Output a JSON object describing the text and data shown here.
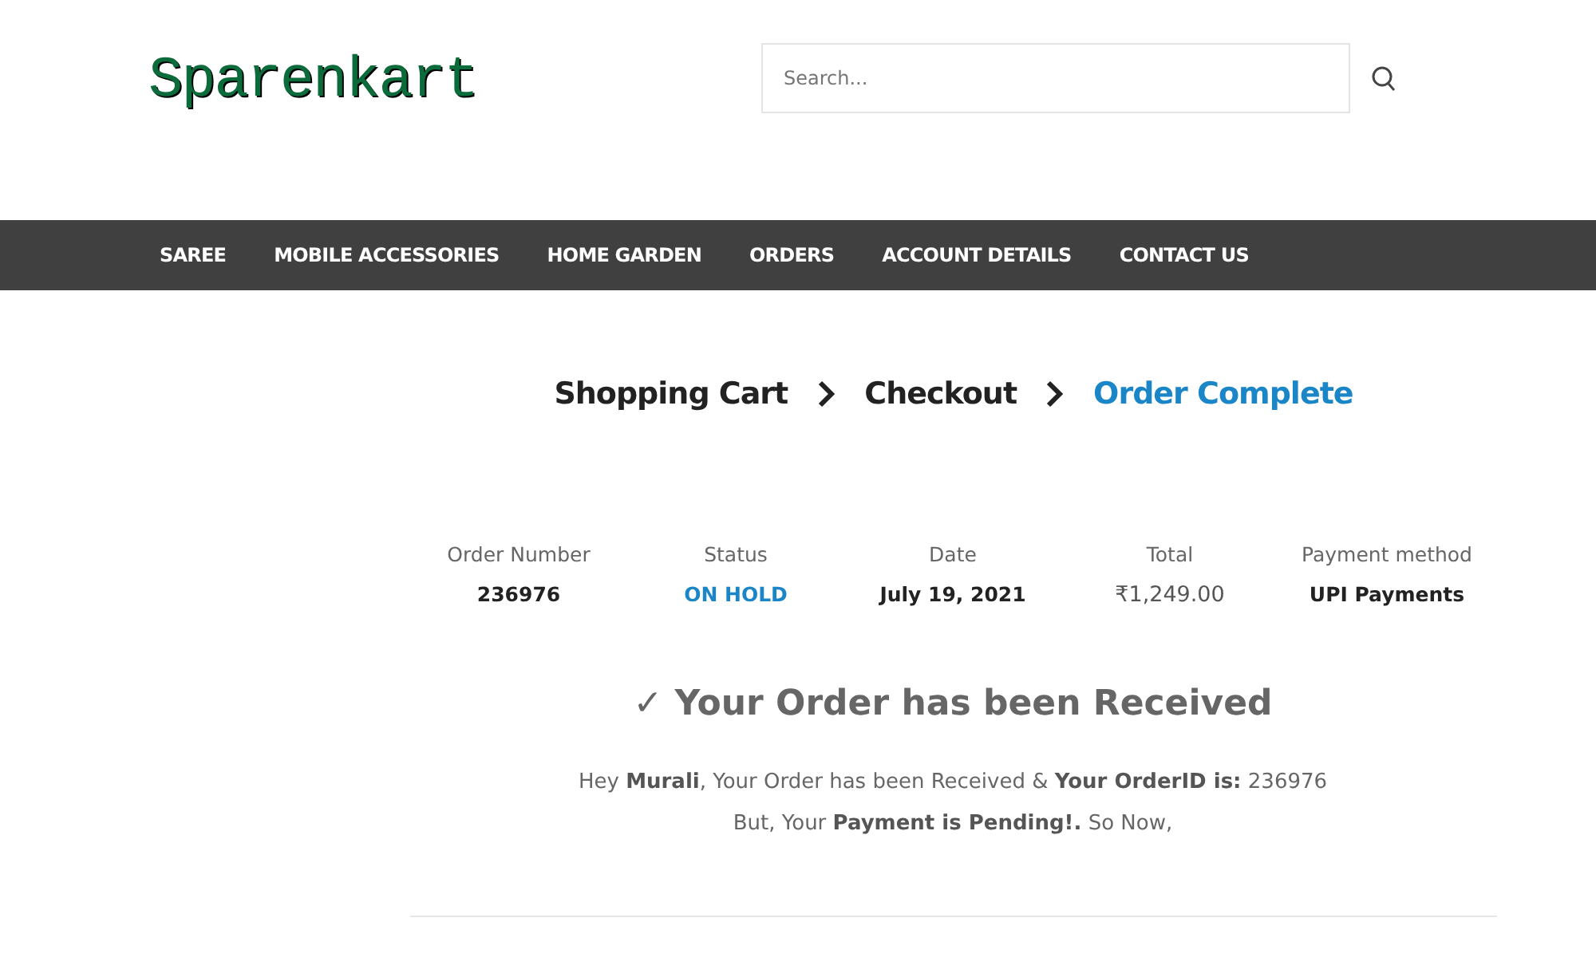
{
  "logo": "Sparenkart",
  "search": {
    "placeholder": "Search..."
  },
  "nav": [
    "SAREE",
    "MOBILE ACCESSORIES",
    "HOME GARDEN",
    "ORDERS",
    "ACCOUNT DETAILS",
    "CONTACT US"
  ],
  "steps": [
    {
      "label": "Shopping Cart",
      "selected": false
    },
    {
      "label": "Checkout",
      "selected": false
    },
    {
      "label": "Order Complete",
      "selected": true
    }
  ],
  "order_details": [
    {
      "label": "Order Number",
      "value": "236976",
      "kind": "bold"
    },
    {
      "label": "Status",
      "value": "ON HOLD",
      "kind": "status"
    },
    {
      "label": "Date",
      "value": "July 19, 2021",
      "kind": "bold"
    },
    {
      "label": "Total",
      "value": "₹1,249.00",
      "kind": "plain"
    },
    {
      "label": "Payment method",
      "value": "UPI Payments",
      "kind": "bold"
    }
  ],
  "heading": "✓ Your Order has been Received",
  "message": [
    "Hey **Murali**, Your Order has been Received & **Your OrderID is:** 236976",
    "But, Your **Payment is Pending!.** So Now,"
  ]
}
